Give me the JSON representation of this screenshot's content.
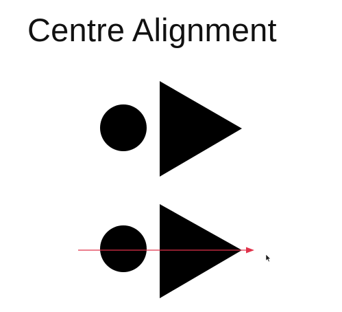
{
  "slide": {
    "title": "Centre Alignment"
  },
  "colors": {
    "background": "#ffffff",
    "shape_fill": "#000000",
    "guide_line": "#e0324a",
    "cursor": "#1a1a1a"
  },
  "icons": {
    "pointer": "mouse-pointer-icon"
  }
}
